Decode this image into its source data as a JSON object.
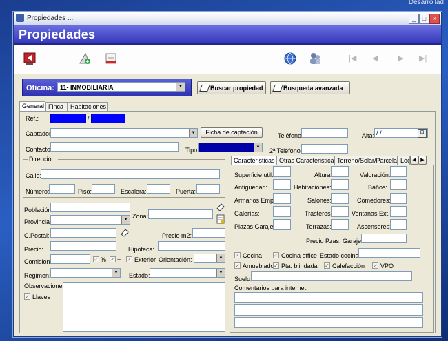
{
  "desktop": {
    "corner_text": "Desarrollad"
  },
  "window": {
    "title": "Propiedades ...",
    "header": "Propiedades",
    "controls": {
      "min": "_",
      "max": "□",
      "close": "×"
    }
  },
  "toolbar": {
    "icons": [
      "exit-icon",
      "new-record-icon",
      "edit-record-icon",
      "web-icon",
      "users-icon"
    ],
    "nav": {
      "first": "|◀",
      "prev": "◀",
      "next": "▶",
      "last": "▶|"
    }
  },
  "oficina": {
    "label": "Oficina:",
    "value": "11- INMOBILIARIA"
  },
  "buttons": {
    "buscar": "Buscar propiedad",
    "avanzada": "Busqueda avanzada"
  },
  "tabs": [
    "General",
    "Finca",
    "Habitaciones"
  ],
  "form": {
    "ref_label": "Ref.:",
    "ref_sep": "/",
    "captador_label": "Captador:",
    "ficha_button": "Ficha de captación",
    "telefono_label": "Teléfono:",
    "alta_label": "Alta:",
    "alta_value": "/ /",
    "contacto_label": "Contacto",
    "tipo_label": "Tipo:",
    "telefono2_label": "2ª Teléfono:",
    "direccion": {
      "title": "Dirección:",
      "calle_label": "Calle:",
      "numero_label": "Número:",
      "piso_label": "Piso:",
      "escalera_label": "Escalera:",
      "puerta_label": "Puerta:"
    },
    "poblacion_label": "Población:",
    "provincia_label": "Provincia:",
    "zona_label": "Zona:",
    "cpostal_label": "C.Postal:",
    "preciom2_label": "Precio m2:",
    "precio_label": "Precio:",
    "hipoteca_label": "Hipoteca:",
    "comision_label": "Comision:",
    "pct_label": "%",
    "plus_label": "+",
    "exterior_label": "Exterior",
    "orientacion_label": "Orientación:",
    "regimen_label": "Regimen:",
    "estado_label": "Estado:",
    "observaciones_label": "Observaciones:",
    "llaves_label": "Llaves"
  },
  "right_tabs": [
    "Caracteristicas",
    "Otras Caracteristicas",
    "Terreno/Solar/Parcela",
    "Loc"
  ],
  "caracteristicas": {
    "col1": [
      "Superficie util:",
      "Antiguedad:",
      "Armarios Emp.:",
      "Galerías:",
      "Plazas Garaje:"
    ],
    "col2": [
      "Altura:",
      "Habitaciones:",
      "Salones:",
      "Trasteros:",
      "Terrazas:"
    ],
    "col3": [
      "Valoración:",
      "Baños:",
      "Comedores:",
      "Ventanas Ext.:",
      "Ascensores:"
    ],
    "precio_garaje_label": "Precio Pzas. Garaje:",
    "cocina_label": "Cocina",
    "cocina_office_label": "Cocina office",
    "estado_cocina_label": "Estado cocina:",
    "amueblado_label": "Amueblado",
    "pta_blindada_label": "Pta. blindada",
    "calefaccion_label": "Calefacción",
    "vpo_label": "VPO",
    "suelo_label": "Suelo:",
    "comentarios_label": "Comentarios para internet:"
  }
}
